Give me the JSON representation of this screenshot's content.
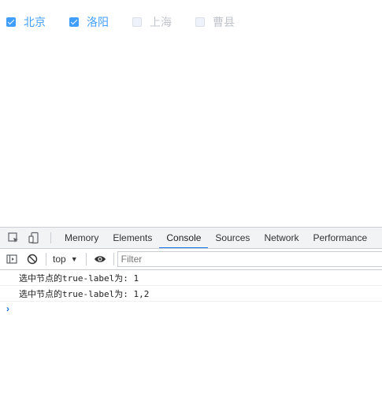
{
  "checkboxes": [
    {
      "label": "北京",
      "state": "checked"
    },
    {
      "label": "洛阳",
      "state": "checked"
    },
    {
      "label": "上海",
      "state": "disabled"
    },
    {
      "label": "曹县",
      "state": "disabled"
    }
  ],
  "devtools": {
    "tabs": [
      "Memory",
      "Elements",
      "Console",
      "Sources",
      "Network",
      "Performance"
    ],
    "active_tab": "Console",
    "context": "top",
    "filter_placeholder": "Filter",
    "console_lines": [
      "选中节点的true-label为: 1",
      "选中节点的true-label为: 1,2"
    ],
    "prompt": "›"
  },
  "colors": {
    "accent": "#409eff",
    "disabled_text": "#c0c4cc",
    "devtools_tab_indicator": "#1a73e8"
  },
  "icons": [
    "inspect-element-icon",
    "device-toggle-icon",
    "sidebar-toggle-icon",
    "clear-console-icon",
    "eye-icon",
    "caret-down-icon"
  ]
}
